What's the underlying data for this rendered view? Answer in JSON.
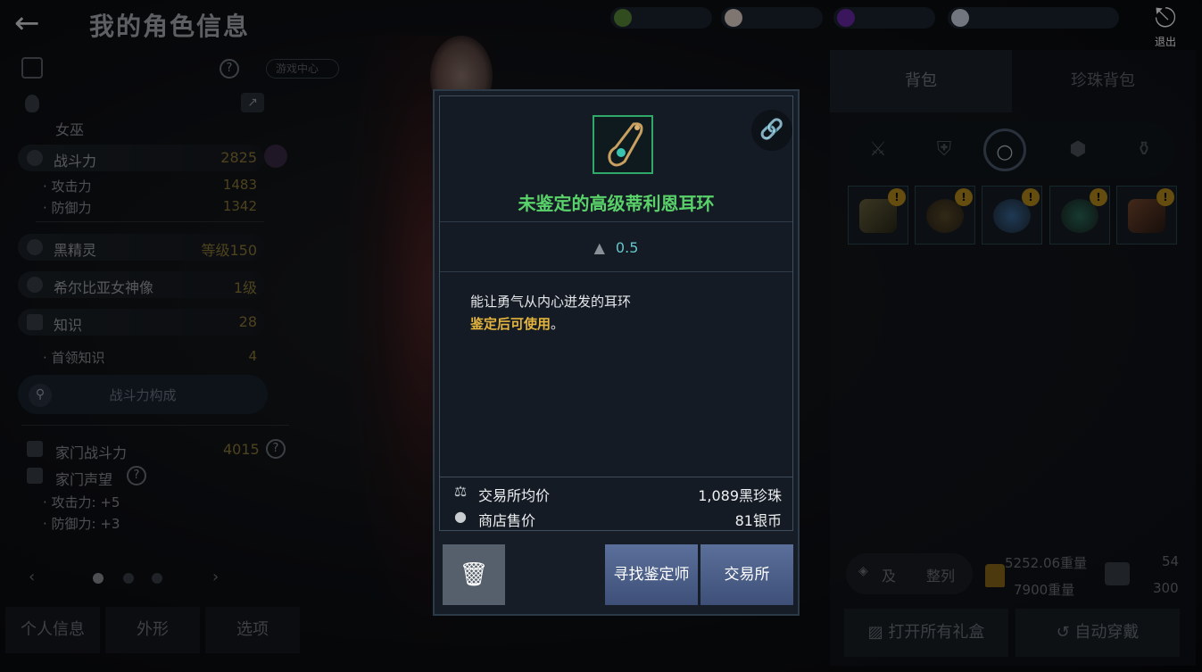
{
  "header": {
    "title": "我的角色信息",
    "exit_label": "退出"
  },
  "colors": {
    "item_name": "#59d26a",
    "highlight": "#e4b43d",
    "weight_value": "#63c6cc",
    "button_blue": "#4a5f8c"
  },
  "left": {
    "class_name": "女巫",
    "guide_label": "游戏中心",
    "stats": [
      {
        "label": "战斗力",
        "value": "2825"
      },
      {
        "label": "攻击力",
        "value": "1483"
      },
      {
        "label": "防御力",
        "value": "1342"
      },
      {
        "label": "黑精灵",
        "value": "等级150"
      },
      {
        "label": "希尔比亚女神像",
        "value": "1级"
      },
      {
        "label": "知识",
        "value": "28"
      },
      {
        "label": "首领知识",
        "value": "4"
      }
    ],
    "power_breakdown": "战斗力构成",
    "family_power_label": "家门战斗力",
    "family_power_value": "4015",
    "family_fame_label": "家门声望",
    "family_attack": "攻击力: +5",
    "family_defense": "防御力: +3",
    "tabs": [
      "个人信息",
      "外形",
      "选项"
    ]
  },
  "right": {
    "tabs": [
      "背包",
      "珍珠背包"
    ],
    "sort_labels": [
      "及",
      "整列"
    ],
    "weight_current": "5252.06重量",
    "weight_max": "7900重量",
    "slots_used": "54",
    "slots_max": "300",
    "open_gifts": "打开所有礼盒",
    "auto_equip": "自动穿戴"
  },
  "modal": {
    "item_name": "未鉴定的高级蒂利恩耳环",
    "weight": "0.5",
    "desc_line1": "能让勇气从内心迸发的耳环",
    "desc_line2": "鉴定后可使用",
    "desc_suffix": "。",
    "market_label": "交易所均价",
    "market_value": "1,089黑珍珠",
    "shop_label": "商店售价",
    "shop_value": "81银币",
    "btn_find": "寻找鉴定师",
    "btn_market": "交易所"
  }
}
